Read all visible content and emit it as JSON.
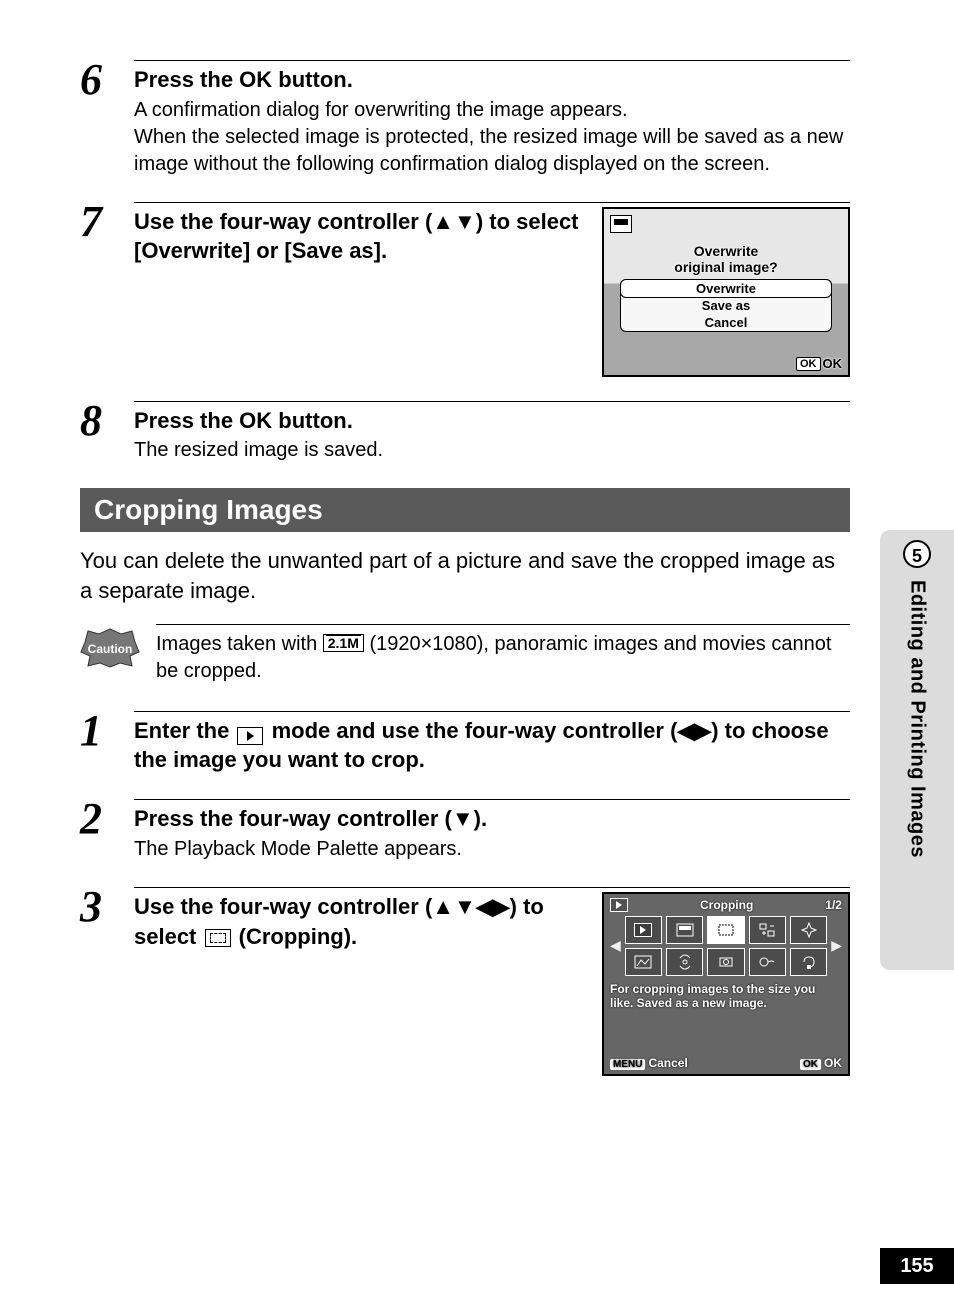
{
  "sidebar": {
    "chapter_number": "5",
    "chapter_title": "Editing and Printing Images"
  },
  "page_number": "155",
  "steps_a": [
    {
      "num": "6",
      "title_pre": "Press the ",
      "title_ok": "OK",
      "title_post": " button.",
      "desc": "A confirmation dialog for overwriting the image appears.\nWhen the selected image is protected, the resized image will be saved as a new image without the following confirmation dialog displayed on the screen."
    },
    {
      "num": "7",
      "title": "Use the four-way controller (▲▼) to select [Overwrite] or [Save as]."
    },
    {
      "num": "8",
      "title_pre": "Press the ",
      "title_ok": "OK",
      "title_post": " button.",
      "desc": "The resized image is saved."
    }
  ],
  "fig1": {
    "prompt_l1": "Overwrite",
    "prompt_l2": "original image?",
    "opt1": "Overwrite",
    "opt2": "Save as",
    "opt3": "Cancel",
    "ok_badge": "OK",
    "ok_text": "OK"
  },
  "heading": "Cropping Images",
  "intro": "You can delete the unwanted part of a picture and save the cropped image as a separate image.",
  "caution": {
    "label": "Caution",
    "res": "2.1M",
    "text_pre": "Images taken with ",
    "text_post": " (1920×1080), panoramic images and movies cannot be cropped."
  },
  "steps_b": [
    {
      "num": "1",
      "title_pre": "Enter the ",
      "title_mid": " mode and use the four-way controller (◀▶) to choose the image you want to crop."
    },
    {
      "num": "2",
      "title": "Press the four-way controller (▼).",
      "desc": "The Playback Mode Palette appears."
    },
    {
      "num": "3",
      "title_pre": "Use the four-way controller (▲▼◀▶) to select ",
      "title_post": " (Cropping)."
    }
  ],
  "fig2": {
    "title": "Cropping",
    "page": "1/2",
    "desc": "For cropping images to the size you like. Saved as a new image.",
    "menu_badge": "MENU",
    "cancel": "Cancel",
    "ok_badge": "OK",
    "ok_text": "OK"
  }
}
